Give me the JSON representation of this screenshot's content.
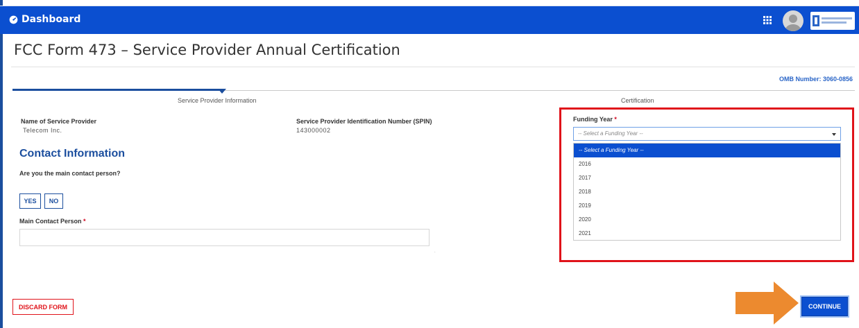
{
  "header": {
    "brand_label": "Dashboard"
  },
  "page": {
    "title": "FCC Form 473 – Service Provider Annual Certification",
    "omb_number": "OMB Number: 3060-0856"
  },
  "steps": [
    {
      "label": "Service Provider Information",
      "active": true
    },
    {
      "label": "Certification",
      "active": false
    }
  ],
  "provider": {
    "name_label": "Name of Service Provider",
    "name_value": "Telecom Inc.",
    "spin_label": "Service Provider Identification Number (SPIN)",
    "spin_value": "143000002"
  },
  "contact": {
    "heading": "Contact Information",
    "question": "Are you the main contact person?",
    "yes_label": "YES",
    "no_label": "NO",
    "main_contact_label": "Main Contact Person",
    "main_contact_value": ""
  },
  "funding_year": {
    "label": "Funding Year",
    "placeholder": "-- Select a Funding Year --",
    "options": [
      "-- Select a Funding Year --",
      "2016",
      "2017",
      "2018",
      "2019",
      "2020",
      "2021"
    ],
    "highlighted_index": 0
  },
  "actions": {
    "discard_label": "DISCARD FORM",
    "continue_label": "CONTINUE"
  },
  "colors": {
    "header_blue": "#0b4fd0",
    "highlight_red": "#e0131a",
    "arrow_orange": "#ec8a2f"
  }
}
